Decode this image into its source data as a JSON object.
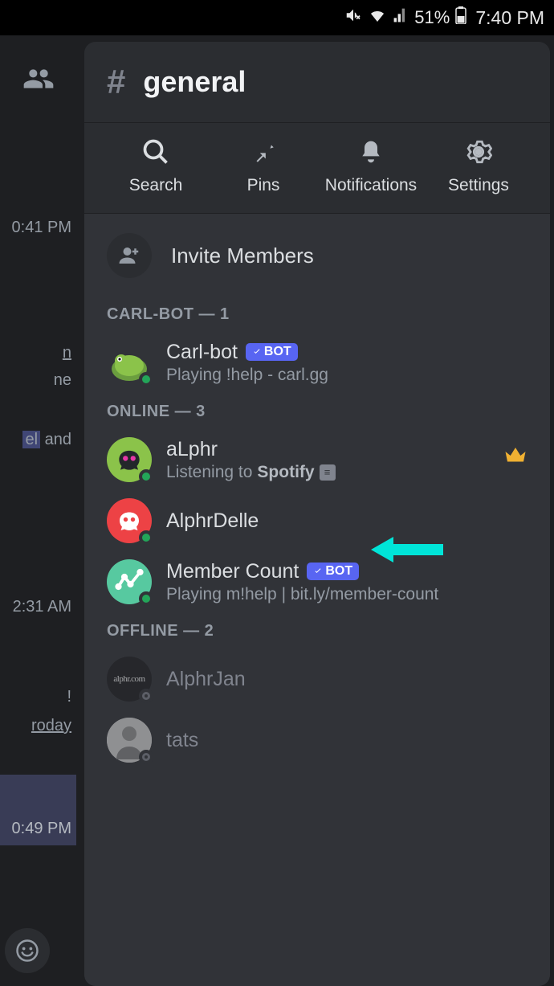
{
  "status_bar": {
    "battery": "51%",
    "time": "7:40 PM"
  },
  "left_col": {
    "timestamps": [
      "0:41 PM",
      "2:31 AM",
      "0:49 PM"
    ],
    "fragments": [
      "n",
      "ne",
      "el and",
      "!",
      "roday"
    ]
  },
  "channel": {
    "name": "general"
  },
  "tabs": [
    {
      "label": "Search"
    },
    {
      "label": "Pins"
    },
    {
      "label": "Notifications"
    },
    {
      "label": "Settings"
    }
  ],
  "invite_label": "Invite Members",
  "sections": {
    "carlbot": {
      "title": "CARL-BOT — 1"
    },
    "online": {
      "title": "ONLINE — 3"
    },
    "offline": {
      "title": "OFFLINE — 2"
    }
  },
  "members": {
    "carlbot": {
      "name": "Carl-bot",
      "bot_badge": "BOT",
      "activity": "Playing !help - carl.gg",
      "avatar_bg": "#8bc34a"
    },
    "alphr": {
      "name": "aLphr",
      "activity_prefix": "Listening to ",
      "activity_bold": "Spotify",
      "avatar_bg": "#8bc34a"
    },
    "alphrdelle": {
      "name": "AlphrDelle",
      "avatar_bg": "#ed4245"
    },
    "membercount": {
      "name": "Member Count",
      "bot_badge": "BOT",
      "activity": "Playing m!help | bit.ly/member-count",
      "avatar_bg": "#57c9a0"
    },
    "alphrjan": {
      "name": "AlphrJan",
      "avatar_text": "alphr.com",
      "avatar_bg": "#1e1f22"
    },
    "tats": {
      "name": "tats",
      "avatar_bg": "#e8e8e8"
    }
  }
}
